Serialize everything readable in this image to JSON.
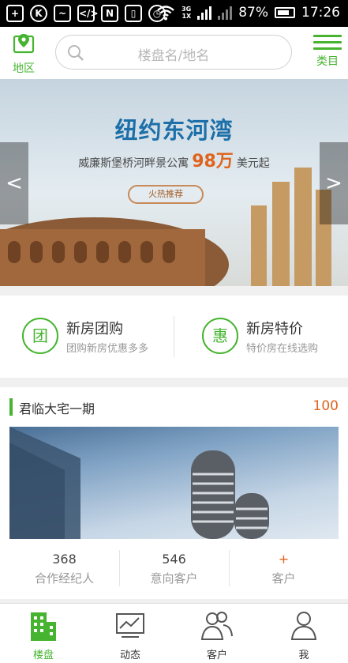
{
  "status_bar": {
    "battery": "87%",
    "time": "17:26",
    "net_1": "3G",
    "net_2": "1X"
  },
  "header": {
    "region_label": "地区",
    "search_placeholder": "楼盘名/地名",
    "category_label": "类目"
  },
  "banner": {
    "title": "纽约东河湾",
    "subtitle_prefix": "威廉斯堡桥河畔景公寓",
    "price": "98万",
    "subtitle_suffix": "美元起",
    "button_label": "火热推荐",
    "prev_label": "<",
    "next_label": ">"
  },
  "features": [
    {
      "icon_char": "团",
      "title": "新房团购",
      "subtitle": "团购新房优惠多多"
    },
    {
      "icon_char": "惠",
      "title": "新房特价",
      "subtitle": "特价房在线选购"
    }
  ],
  "listing": {
    "title": "君临大宅一期",
    "count": "100",
    "stats": [
      {
        "value": "368",
        "label": "合作经纪人"
      },
      {
        "value": "546",
        "label": "意向客户"
      },
      {
        "value": "+",
        "label": "客户"
      }
    ]
  },
  "tabs": [
    {
      "label": "楼盘"
    },
    {
      "label": "动态"
    },
    {
      "label": "客户"
    },
    {
      "label": "我"
    }
  ],
  "colors": {
    "accent": "#46b430",
    "price": "#e0631c",
    "banner_title": "#1c6fa8"
  }
}
